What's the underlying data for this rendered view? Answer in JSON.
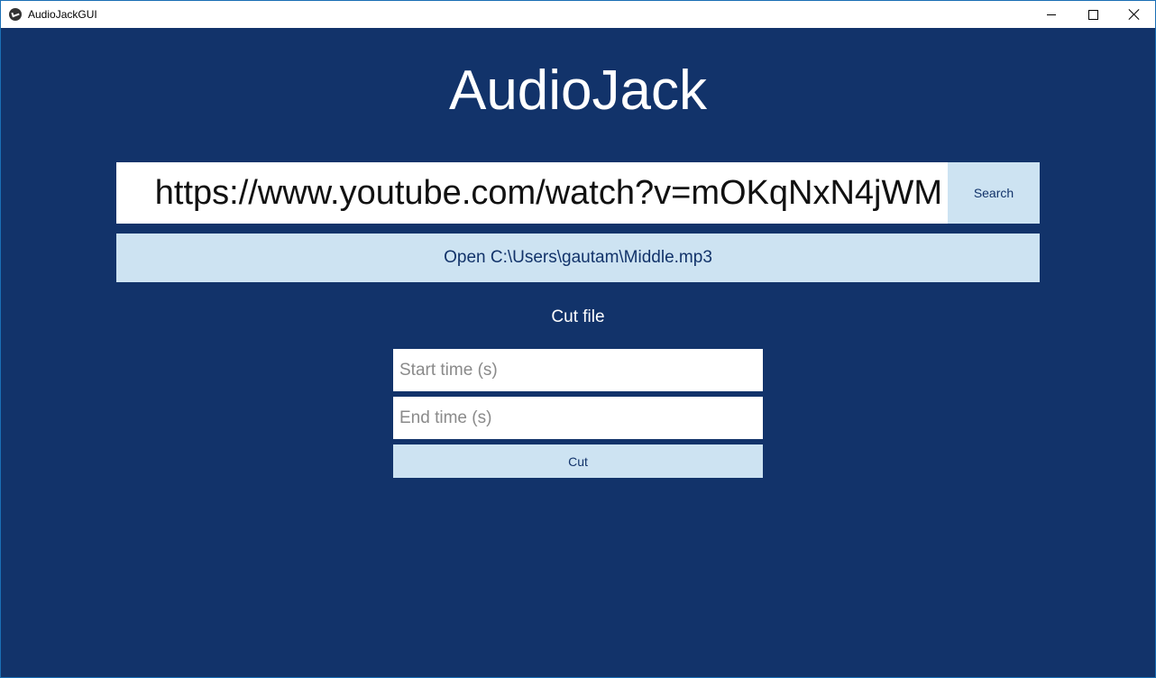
{
  "window": {
    "title": "AudioJackGUI",
    "controls": [
      "minimize-icon",
      "maximize-icon",
      "close-icon"
    ]
  },
  "app": {
    "heading": "AudioJack"
  },
  "search": {
    "url_value": "https://www.youtube.com/watch?v=mOKqNxN4jWM",
    "button_label": "Search"
  },
  "open": {
    "button_label": "Open C:\\Users\\gautam\\Middle.mp3"
  },
  "cut": {
    "section_label": "Cut file",
    "start_placeholder": "Start time (s)",
    "end_placeholder": "End time (s)",
    "button_label": "Cut"
  },
  "colors": {
    "background": "#12336a",
    "button": "#cde3f2",
    "button_text": "#12336a",
    "placeholder": "#8a8a8a"
  }
}
